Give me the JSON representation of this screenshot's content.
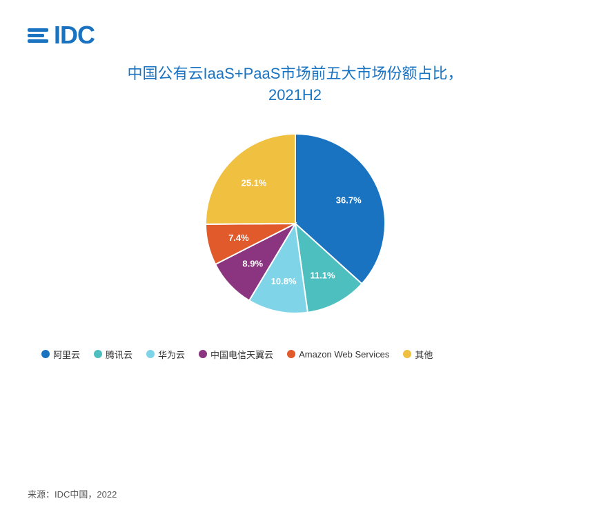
{
  "logo": {
    "text": "IDC"
  },
  "title": {
    "line1": "中国公有云IaaS+PaaS市场前五大市场份额占比，",
    "line2": "2021H2"
  },
  "chart": {
    "segments": [
      {
        "name": "阿里云",
        "value": 36.7,
        "color": "#1a73c1",
        "startAngle": -90,
        "labelAngle": 30
      },
      {
        "name": "腾讯云",
        "value": 11.1,
        "color": "#4dbfbf",
        "startAngle": 42.12,
        "labelAngle": 90
      },
      {
        "name": "华为云",
        "value": 10.8,
        "color": "#7fd4e8",
        "startAngle": 82.08,
        "labelAngle": 140
      },
      {
        "name": "中国电信天翼云",
        "value": 8.9,
        "color": "#8b3580",
        "startAngle": 120.96,
        "labelAngle": 182
      },
      {
        "name": "Amazon Web Services",
        "value": 7.4,
        "color": "#e05a2b",
        "startAngle": 153.0,
        "labelAngle": 212
      },
      {
        "name": "其他",
        "value": 25.1,
        "color": "#f0c040",
        "startAngle": 179.64,
        "labelAngle": 292
      }
    ]
  },
  "legend": [
    {
      "label": "阿里云",
      "color": "#1a73c1"
    },
    {
      "label": "腾讯云",
      "color": "#4dbfbf"
    },
    {
      "label": "华为云",
      "color": "#7fd4e8"
    },
    {
      "label": "中国电信天翼云",
      "color": "#8b3580"
    },
    {
      "label": "Amazon Web Services",
      "color": "#e05a2b"
    },
    {
      "label": "其他",
      "color": "#f0c040"
    }
  ],
  "source": "来源：IDC中国，2022"
}
